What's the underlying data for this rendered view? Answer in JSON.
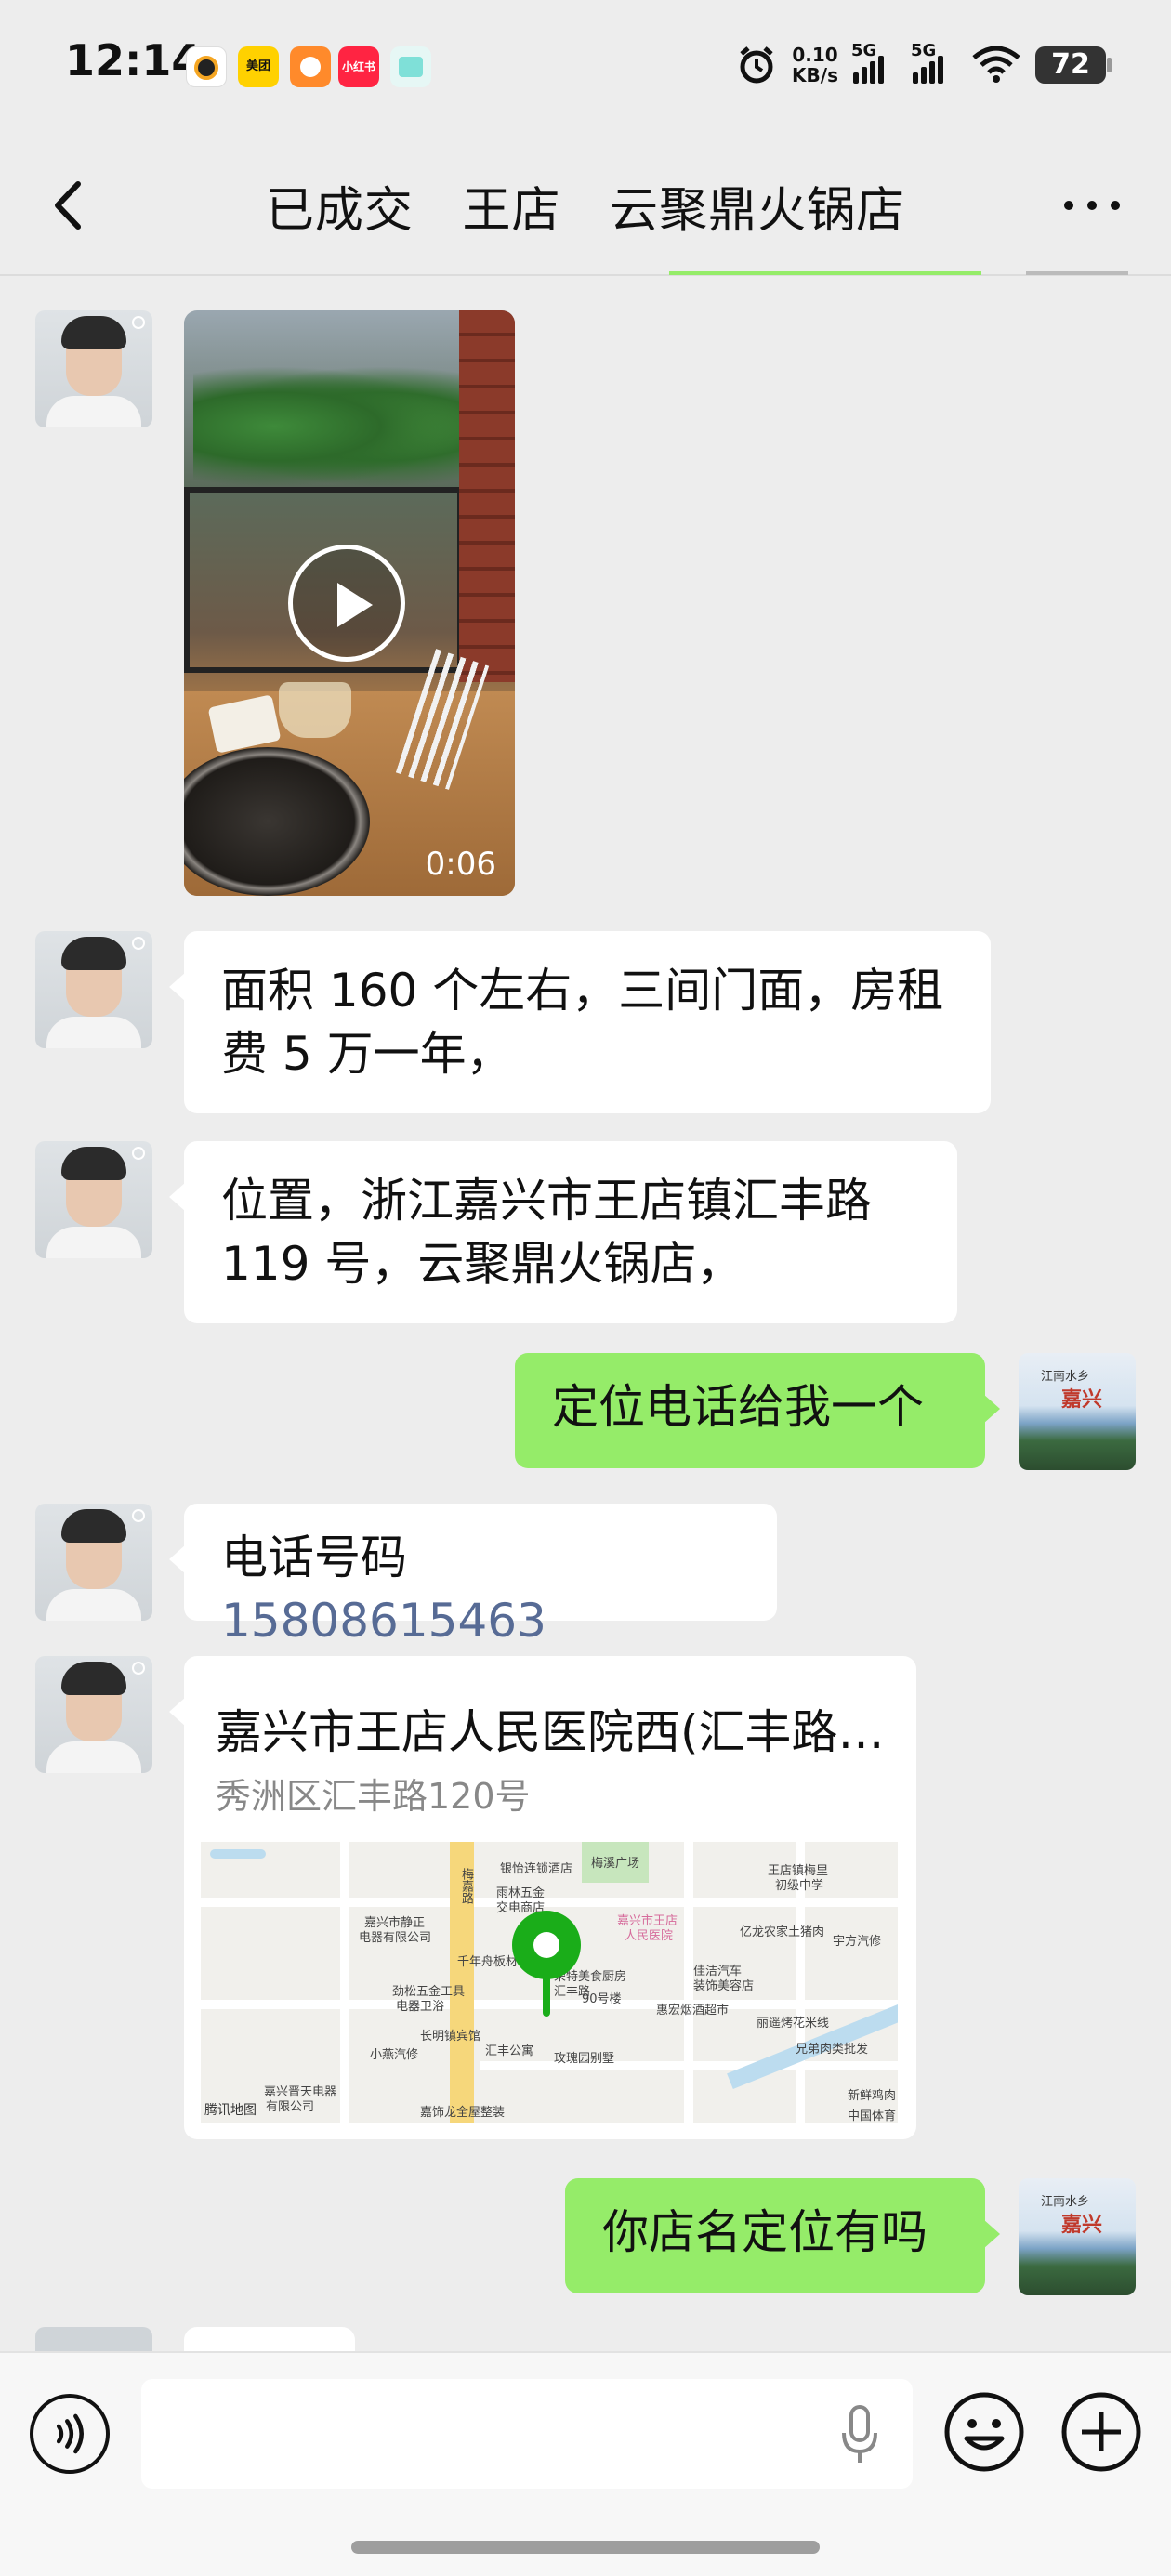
{
  "status_bar": {
    "time": "12:14",
    "apps": [
      {
        "icon": "app-icon-white",
        "label": "",
        "color": "#ffffff"
      },
      {
        "icon": "meituan-icon",
        "label": "美团",
        "color": "#ffd100"
      },
      {
        "icon": "video-app-icon",
        "label": "",
        "color": "#ff8a2b"
      },
      {
        "icon": "xiaohongshu-icon",
        "label": "小红书",
        "color": "#ff2442"
      },
      {
        "icon": "app-icon-cyan",
        "label": "",
        "color": "#7fe0d8"
      }
    ],
    "net_speed_value": "0.10",
    "net_speed_unit": "KB/s",
    "sim1": "5G",
    "sim2": "5G",
    "battery": "72"
  },
  "header": {
    "title": "已成交   王店   云聚鼎火锅店"
  },
  "messages": {
    "video_duration": "0:06",
    "msg1": "面积 160 个左右，三间门面，房租费 5 万一年，",
    "msg2": "位置，浙江嘉兴市王店镇汇丰路 119 号，云聚鼎火锅店，",
    "msg3": "定位电话给我一个",
    "msg4_prefix": "电话号码 ",
    "msg4_phone": "15808615463",
    "location_title": "嘉兴市王店人民医院西(汇丰路…",
    "location_address": "秀洲区汇丰路120号",
    "msg5": "你店名定位有吗"
  },
  "map": {
    "labels": [
      "梅溪广场",
      "王店镇梅里",
      "初级中学",
      "亿龙农家土猪肉",
      "嘉兴市王店",
      "人民医院",
      "嘉兴市静正",
      "电器有限公司",
      "雨林五金",
      "交电商店",
      "千年舟板材",
      "荣特美食厨房",
      "汇丰路",
      "佳洁汽车",
      "装饰美容店",
      "惠宏烟酒超市",
      "劲松五金工具",
      "电器卫浴",
      "长明镇宾馆",
      "丽遥烤花米线",
      "小燕汽修",
      "汇丰公寓",
      "玫瑰园别墅",
      "兄弟肉类批发",
      "嘉兴晋天电器",
      "有限公司",
      "新鲜鸡肉",
      "中国体育",
      "嘉饰龙全屋整装",
      "梅嘉路",
      "90号楼",
      "宇方汽修",
      "银怡连锁酒店"
    ],
    "brand": "腾讯地图",
    "accent": "#1aad19"
  },
  "colors": {
    "background": "#ededed",
    "bubble_self": "#95ec69",
    "bubble_other": "#ffffff",
    "link": "#576b95"
  },
  "icons": {
    "back": "chevron-left-icon",
    "more": "more-dots-icon",
    "play": "play-icon",
    "voice": "voice-icon",
    "mic": "mic-icon",
    "emoji": "emoji-icon",
    "plus": "plus-icon"
  }
}
